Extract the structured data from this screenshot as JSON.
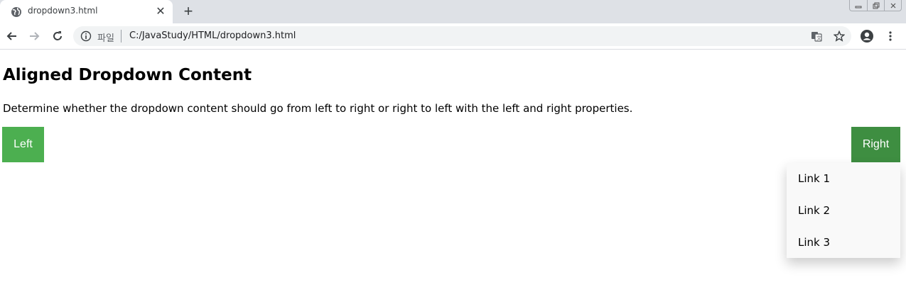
{
  "browser": {
    "tab": {
      "title": "dropdown3.html",
      "favicon": "globe-icon"
    },
    "address": {
      "scheme_label": "파일",
      "url": "C:/JavaStudy/HTML/dropdown3.html"
    }
  },
  "page": {
    "heading": "Aligned Dropdown Content",
    "description": "Determine whether the dropdown content should go from left to right or right to left with the left and right properties.",
    "left_button": "Left",
    "right_button": "Right",
    "dropdown_links": [
      "Link 1",
      "Link 2",
      "Link 3"
    ]
  },
  "colors": {
    "button": "#4caf50",
    "button_hover": "#3e8e41",
    "dropdown_bg": "#f9f9f9"
  }
}
